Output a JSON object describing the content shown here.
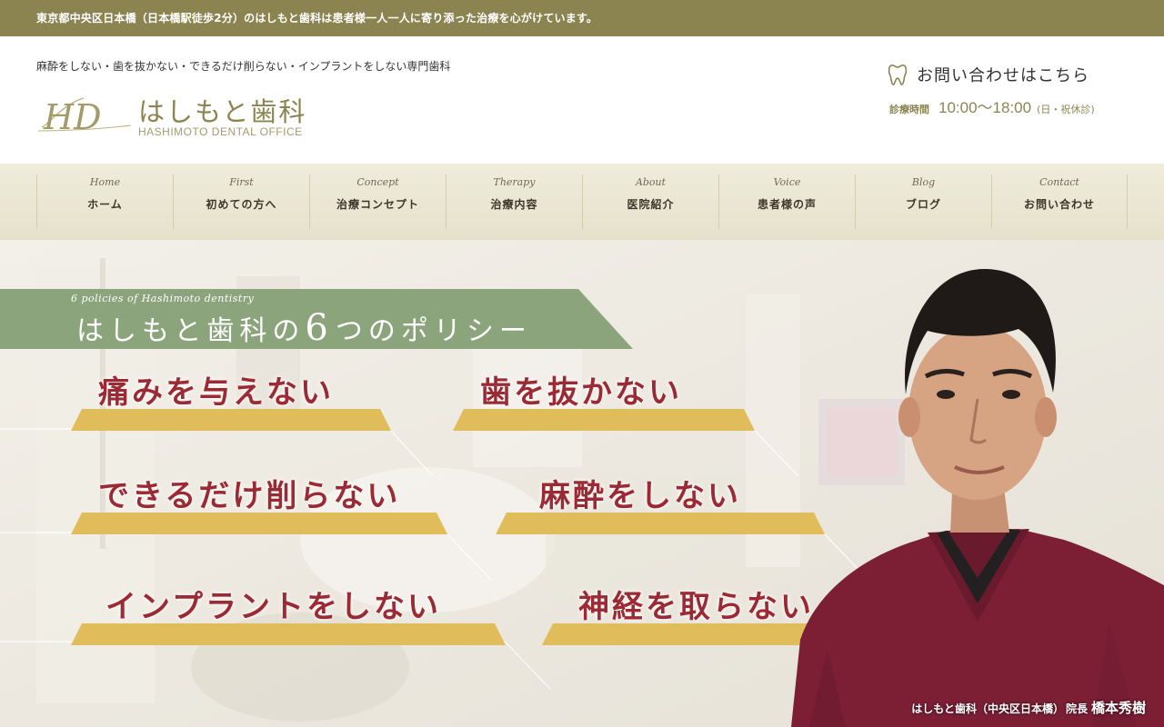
{
  "topbar": {
    "text": "東京都中央区日本橋（日本橋駅徒歩2分）のはしもと歯科は患者様一人一人に寄り添った治療を心がけています。"
  },
  "header": {
    "tagline": "麻酔をしない・歯を抜かない・できるだけ削らない・インプラントをしない専門歯科",
    "logo_mark": "HD",
    "logo_name": "はしもと歯科",
    "logo_sub": "HASHIMOTO DENTAL OFFICE",
    "contact_label": "お問い合わせはこちら",
    "hours_label": "診療時間",
    "hours_value": "10:00〜18:00",
    "hours_note": "(日・祝休診)",
    "contact_icon": "tooth-icon"
  },
  "nav": {
    "items": [
      {
        "en": "Home",
        "ja": "ホーム"
      },
      {
        "en": "First",
        "ja": "初めての方へ"
      },
      {
        "en": "Concept",
        "ja": "治療コンセプト"
      },
      {
        "en": "Therapy",
        "ja": "治療内容"
      },
      {
        "en": "About",
        "ja": "医院紹介"
      },
      {
        "en": "Voice",
        "ja": "患者様の声"
      },
      {
        "en": "Blog",
        "ja": "ブログ"
      },
      {
        "en": "Contact",
        "ja": "お問い合わせ"
      }
    ]
  },
  "hero": {
    "policy_en": "6 policies of Hashimoto dentistry",
    "policy_title_pre": "はしもと歯科の",
    "policy_title_num": "6",
    "policy_title_post": "つのポリシー",
    "policies": [
      "痛みを与えない",
      "歯を抜かない",
      "できるだけ削らない",
      "麻酔をしない",
      "インプラントをしない",
      "神経を取らない"
    ],
    "caption_clinic": "はしもと歯科（中央区日本橋）",
    "caption_role": "院長",
    "caption_name": "橋本秀樹"
  },
  "colors": {
    "brand_olive": "#8c8450",
    "banner_green": "#8ca47c",
    "policy_red": "#9b2a35",
    "ribbon_gold": "#e0bc5a"
  }
}
